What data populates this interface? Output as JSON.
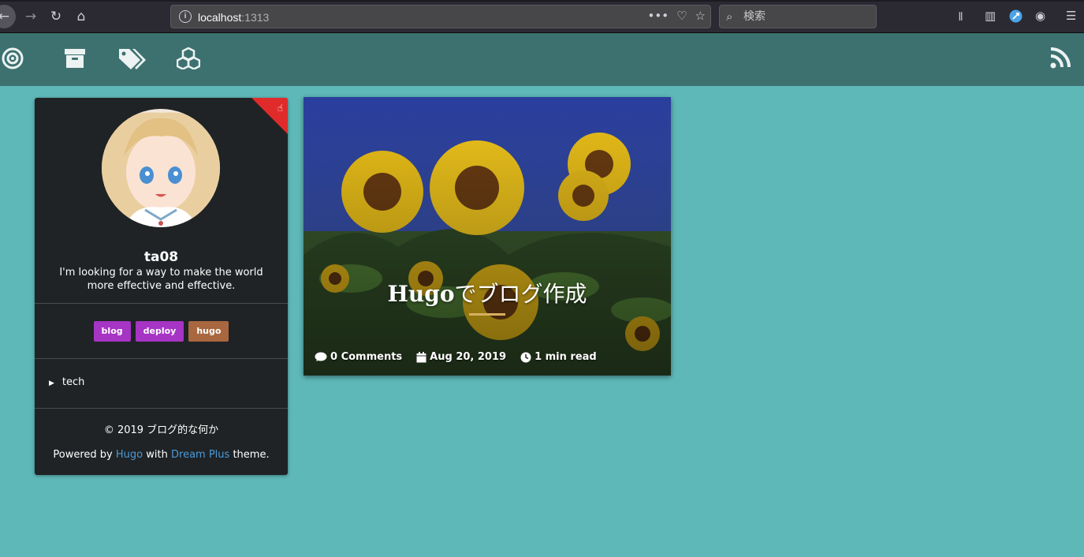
{
  "browser": {
    "url_host": "localhost",
    "url_port": ":1313",
    "search_placeholder": "検索"
  },
  "sidebar": {
    "author_name": "ta08",
    "bio": "I'm looking for a way to make the world more effective and effective.",
    "tags": [
      {
        "label": "blog",
        "color": "#a634c4"
      },
      {
        "label": "deploy",
        "color": "#a634c4"
      },
      {
        "label": "hugo",
        "color": "#a8673f"
      }
    ],
    "category": "tech",
    "copyright": "© 2019 ブログ的な何か",
    "powered_prefix": "Powered by",
    "powered_hugo": "Hugo",
    "powered_with": "with",
    "powered_theme": "Dream Plus",
    "powered_suffix": "theme."
  },
  "post": {
    "title_latin": "Hugo",
    "title_jp": "でブログ作成",
    "comments": "0 Comments",
    "date": "Aug 20, 2019",
    "read_time": "1 min read"
  },
  "colors": {
    "page_bg": "#5fb8b8",
    "nav_bg": "#3d7170",
    "card_bg": "#1f2325",
    "ribbon": "#e02b2b",
    "link": "#4b9ad8"
  }
}
